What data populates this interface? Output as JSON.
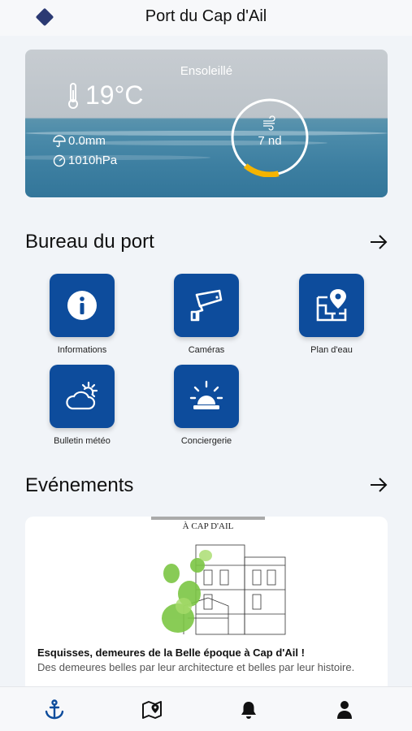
{
  "header": {
    "title": "Port du Cap d'Ail"
  },
  "weather": {
    "condition": "Ensoleillé",
    "temperature": "19°C",
    "rain": "0.0mm",
    "pressure": "1010hPa",
    "wind": "7 nd",
    "wind_gauge_fraction": 0.15,
    "accent_color": "#f5b400"
  },
  "bureau": {
    "title": "Bureau du port",
    "tiles": [
      {
        "label": "Informations",
        "icon": "info-icon"
      },
      {
        "label": "Caméras",
        "icon": "camera-icon"
      },
      {
        "label": "Plan d'eau",
        "icon": "map-pin-icon"
      },
      {
        "label": "Bulletin météo",
        "icon": "weather-icon"
      },
      {
        "label": "Conciergerie",
        "icon": "alarm-light-icon"
      }
    ],
    "tile_color": "#0d4c9c"
  },
  "events": {
    "title": "Evénements",
    "items": [
      {
        "image_caption": "À CAP D'AIL",
        "title": "Esquisses, demeures de la Belle époque  à Cap d'Ail !",
        "description": "Des demeures belles par leur architecture et belles par leur histoire."
      }
    ]
  },
  "bottom_nav": {
    "items": [
      {
        "icon": "anchor-icon",
        "active": true
      },
      {
        "icon": "map-icon",
        "active": false
      },
      {
        "icon": "bell-icon",
        "active": false
      },
      {
        "icon": "user-icon",
        "active": false
      }
    ],
    "active_color": "#0d4c9c"
  }
}
